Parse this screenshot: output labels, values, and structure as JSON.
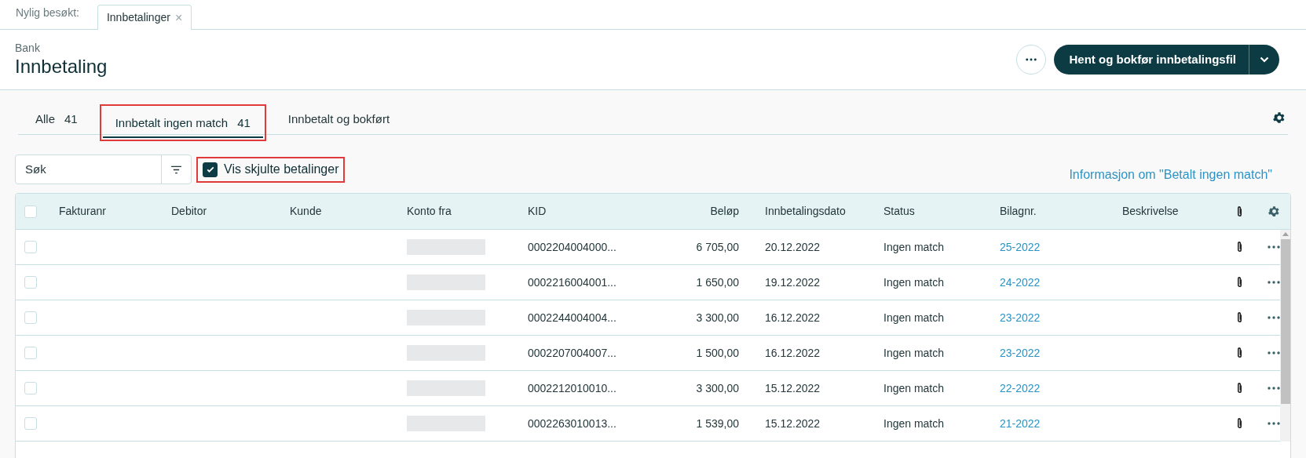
{
  "recent_bar": {
    "label": "Nylig besøkt:",
    "tabs": [
      {
        "label": "Innbetalinger",
        "selected": true,
        "close": "×"
      }
    ]
  },
  "header": {
    "breadcrumb": "Bank",
    "title": "Innbetaling",
    "primary_button": "Hent og bokfør innbetalingsfil"
  },
  "tabs": [
    {
      "label": "Alle",
      "count": "41",
      "selected": false,
      "highlighted": false
    },
    {
      "label": "Innbetalt ingen match",
      "count": "41",
      "selected": true,
      "highlighted": true
    },
    {
      "label": "Innbetalt og bokført",
      "selected": false,
      "highlighted": false
    }
  ],
  "search": {
    "placeholder": "Søk"
  },
  "show_hidden": {
    "label": "Vis skjulte betalinger",
    "checked": true,
    "highlighted": true
  },
  "info_link": "Informasjon om \"Betalt ingen match\"",
  "table": {
    "select_all_checked": false,
    "columns": [
      "Fakturanr",
      "Debitor",
      "Kunde",
      "Konto fra",
      "KID",
      "Beløp",
      "Innbetalingsdato",
      "Status",
      "Bilagnr.",
      "Beskrivelse"
    ],
    "rows": [
      {
        "checked": false,
        "kid": "0002204004000...",
        "amount": "6 705,00",
        "date": "20.12.2022",
        "status": "Ingen match",
        "voucher": "25-2022"
      },
      {
        "checked": false,
        "kid": "0002216004001...",
        "amount": "1 650,00",
        "date": "19.12.2022",
        "status": "Ingen match",
        "voucher": "24-2022"
      },
      {
        "checked": false,
        "kid": "0002244004004...",
        "amount": "3 300,00",
        "date": "16.12.2022",
        "status": "Ingen match",
        "voucher": "23-2022"
      },
      {
        "checked": false,
        "kid": "0002207004007...",
        "amount": "1 500,00",
        "date": "16.12.2022",
        "status": "Ingen match",
        "voucher": "23-2022"
      },
      {
        "checked": false,
        "kid": "0002212010010...",
        "amount": "3 300,00",
        "date": "15.12.2022",
        "status": "Ingen match",
        "voucher": "22-2022"
      },
      {
        "checked": false,
        "kid": "0002263010013...",
        "amount": "1 539,00",
        "date": "15.12.2022",
        "status": "Ingen match",
        "voucher": "21-2022"
      }
    ]
  }
}
